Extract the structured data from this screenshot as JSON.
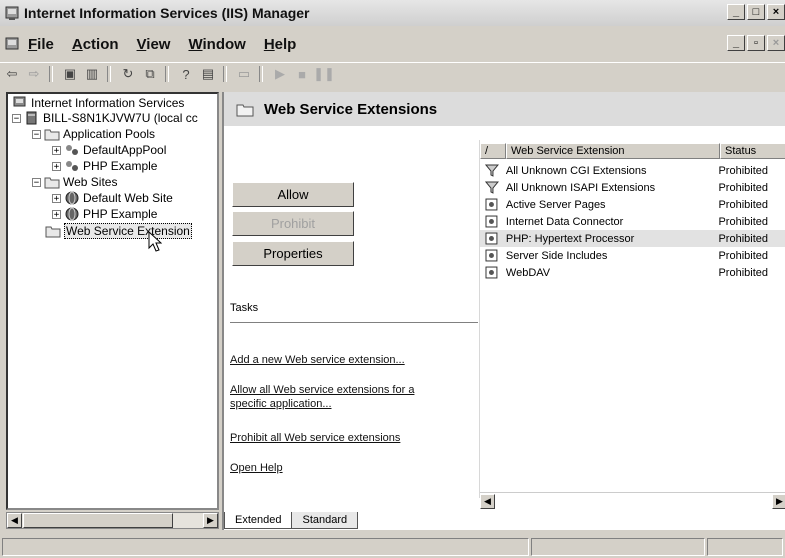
{
  "window": {
    "title": "Internet Information Services (IIS) Manager"
  },
  "menubar": {
    "items": [
      {
        "label": "File",
        "ul": "F"
      },
      {
        "label": "Action",
        "ul": "A"
      },
      {
        "label": "View",
        "ul": "V"
      },
      {
        "label": "Window",
        "ul": "W"
      },
      {
        "label": "Help",
        "ul": "H"
      }
    ]
  },
  "tree": {
    "root": "Internet Information Services",
    "server": "BILL-S8N1KJVW7U (local cc",
    "app_pools": "Application Pools",
    "default_app_pool": "DefaultAppPool",
    "php_example_pool": "PHP Example",
    "web_sites": "Web Sites",
    "default_web_site": "Default Web Site",
    "php_example_site": "PHP Example",
    "web_service_extensions": "Web Service Extension"
  },
  "panel": {
    "title": "Web Service Extensions",
    "buttons": {
      "allow": "Allow",
      "prohibit": "Prohibit",
      "properties": "Properties"
    },
    "tasks_label": "Tasks",
    "links": {
      "add": "Add a new Web service extension...",
      "allow_all_1": "Allow all Web service extensions for a",
      "allow_all_2": "specific application...",
      "prohibit_all": "Prohibit all Web service extensions",
      "open_help": "Open Help"
    }
  },
  "list": {
    "col_name": "Web Service Extension",
    "col_status": "Status",
    "rows": [
      {
        "name": "All Unknown CGI Extensions",
        "status": "Prohibited",
        "icon": "filter-icon"
      },
      {
        "name": "All Unknown ISAPI Extensions",
        "status": "Prohibited",
        "icon": "filter-icon"
      },
      {
        "name": "Active Server Pages",
        "status": "Prohibited",
        "icon": "extension-icon"
      },
      {
        "name": "Internet Data Connector",
        "status": "Prohibited",
        "icon": "extension-icon"
      },
      {
        "name": "PHP: Hypertext Processor",
        "status": "Prohibited",
        "icon": "extension-icon"
      },
      {
        "name": "Server Side Includes",
        "status": "Prohibited",
        "icon": "extension-icon"
      },
      {
        "name": "WebDAV",
        "status": "Prohibited",
        "icon": "extension-icon"
      }
    ]
  },
  "tabs": {
    "extended": "Extended",
    "standard": "Standard"
  }
}
